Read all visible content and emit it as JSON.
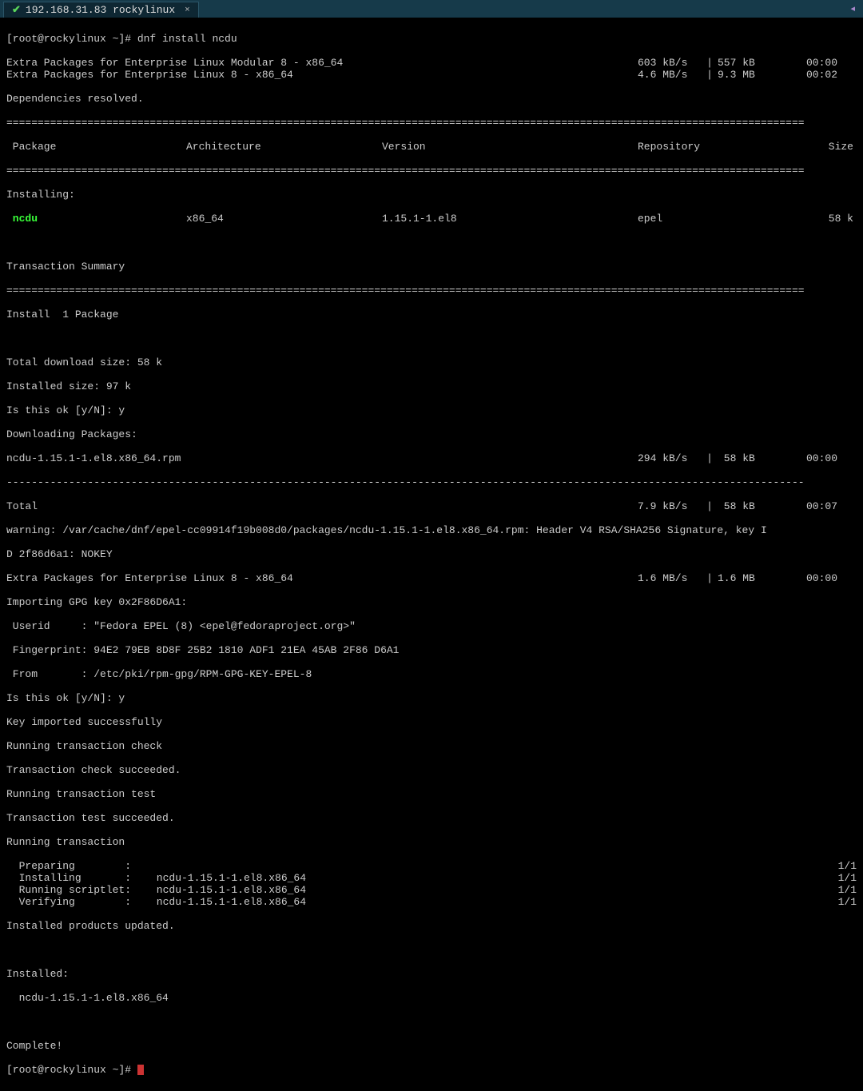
{
  "tab": {
    "label": "192.168.31.83 rockylinux",
    "close": "×",
    "check": "✔",
    "right_icon": "◂"
  },
  "prompt1": "[root@rockylinux ~]# ",
  "cmd": "dnf install ncdu",
  "repo_lines": [
    {
      "name": "Extra Packages for Enterprise Linux Modular 8 - x86_64",
      "rate": "603 kB/s",
      "sep": "|",
      "amt": "557 kB",
      "time": "00:00"
    },
    {
      "name": "Extra Packages for Enterprise Linux 8 - x86_64",
      "rate": "4.6 MB/s",
      "sep": "|",
      "amt": "9.3 MB",
      "time": "00:02"
    }
  ],
  "deps_resolved": "Dependencies resolved.",
  "hr": "================================================================================================================================",
  "dash": "--------------------------------------------------------------------------------------------------------------------------------",
  "headers": {
    "pkg": " Package",
    "arch": "Architecture",
    "ver": "Version",
    "repo": "Repository",
    "size": "Size"
  },
  "installing_label": "Installing:",
  "pkg_row": {
    "name": " ncdu",
    "arch": "x86_64",
    "ver": "1.15.1-1.el8",
    "repo": "epel",
    "size": "58 k"
  },
  "trans_summary": "Transaction Summary",
  "install_count": "Install  1 Package",
  "dlsize": "Total download size: 58 k",
  "instsize": "Installed size: 97 k",
  "confirm1": "Is this ok [y/N]: y",
  "dl_pkgs": "Downloading Packages:",
  "dl_line": {
    "name": "ncdu-1.15.1-1.el8.x86_64.rpm",
    "rate": "294 kB/s",
    "sep": "|",
    "amt": " 58 kB",
    "time": "00:00"
  },
  "total_line": {
    "name": "Total",
    "rate": "7.9 kB/s",
    "sep": "|",
    "amt": " 58 kB",
    "time": "00:07"
  },
  "warning1": "warning: /var/cache/dnf/epel-cc09914f19b008d0/packages/ncdu-1.15.1-1.el8.x86_64.rpm: Header V4 RSA/SHA256 Signature, key I",
  "warning2": "D 2f86d6a1: NOKEY",
  "epel_line": {
    "name": "Extra Packages for Enterprise Linux 8 - x86_64",
    "rate": "1.6 MB/s",
    "sep": "|",
    "amt": "1.6 MB",
    "time": "00:00"
  },
  "import_gpg": "Importing GPG key 0x2F86D6A1:",
  "userid": " Userid     : \"Fedora EPEL (8) <epel@fedoraproject.org>\"",
  "fingerprint": " Fingerprint: 94E2 79EB 8D8F 25B2 1810 ADF1 21EA 45AB 2F86 D6A1",
  "from": " From       : /etc/pki/rpm-gpg/RPM-GPG-KEY-EPEL-8",
  "confirm2": "Is this ok [y/N]: y",
  "key_imported": "Key imported successfully",
  "run_check": "Running transaction check",
  "check_ok": "Transaction check succeeded.",
  "run_test": "Running transaction test",
  "test_ok": "Transaction test succeeded.",
  "run_trans": "Running transaction",
  "trans_rows": [
    {
      "lbl": "  Preparing        :",
      "val": " ",
      "frac": "1/1"
    },
    {
      "lbl": "  Installing       :",
      "val": " ncdu-1.15.1-1.el8.x86_64",
      "frac": "1/1"
    },
    {
      "lbl": "  Running scriptlet:",
      "val": " ncdu-1.15.1-1.el8.x86_64",
      "frac": "1/1"
    },
    {
      "lbl": "  Verifying        :",
      "val": " ncdu-1.15.1-1.el8.x86_64",
      "frac": "1/1"
    }
  ],
  "updated": "Installed products updated.",
  "installed_hdr": "Installed:",
  "installed_pkg": "  ncdu-1.15.1-1.el8.x86_64",
  "complete": "Complete!",
  "prompt2": "[root@rockylinux ~]# "
}
